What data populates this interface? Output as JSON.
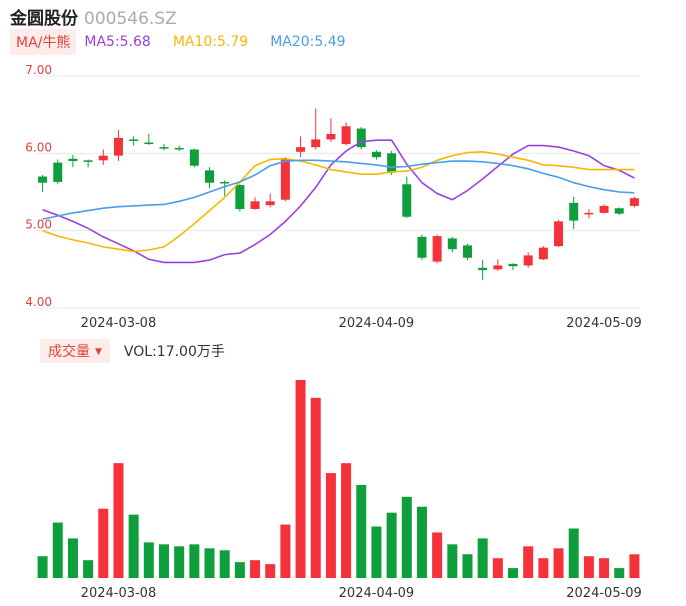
{
  "header": {
    "name": "金圆股份",
    "code": "000546.SZ"
  },
  "ma": {
    "button_label": "MA/牛熊",
    "ma5_label": "MA5:5.68",
    "ma10_label": "MA10:5.79",
    "ma20_label": "MA20:5.49",
    "colors": {
      "ma5": "#9b40e0",
      "ma10": "#f5b800",
      "ma20": "#4a9de8"
    }
  },
  "volume_header": {
    "button_label": "成交量",
    "value_label": "VOL:17.00万手"
  },
  "colors": {
    "up": "#f5323a",
    "down": "#0e9e3c"
  },
  "chart_data": [
    {
      "type": "candlestick",
      "ylim": [
        4.0,
        7.0
      ],
      "y_ticks": [
        "7.00",
        "6.00",
        "5.00",
        "4.00"
      ],
      "x_tick_labels": [
        "2024-03-08",
        "2024-04-09",
        "2024-05-09"
      ],
      "x_tick_indices": [
        5,
        22,
        37
      ],
      "candles": [
        {
          "o": 5.7,
          "c": 5.62,
          "h": 5.72,
          "l": 5.5
        },
        {
          "o": 5.88,
          "c": 5.63,
          "h": 5.92,
          "l": 5.6
        },
        {
          "o": 5.93,
          "c": 5.9,
          "h": 5.98,
          "l": 5.82
        },
        {
          "o": 5.91,
          "c": 5.89,
          "h": 5.92,
          "l": 5.82
        },
        {
          "o": 5.91,
          "c": 5.97,
          "h": 6.05,
          "l": 5.85
        },
        {
          "o": 5.97,
          "c": 6.2,
          "h": 6.3,
          "l": 5.9
        },
        {
          "o": 6.18,
          "c": 6.17,
          "h": 6.22,
          "l": 6.1
        },
        {
          "o": 6.14,
          "c": 6.12,
          "h": 6.25,
          "l": 6.11
        },
        {
          "o": 6.08,
          "c": 6.07,
          "h": 6.12,
          "l": 6.04
        },
        {
          "o": 6.07,
          "c": 6.05,
          "h": 6.1,
          "l": 6.03
        },
        {
          "o": 6.05,
          "c": 5.84,
          "h": 6.06,
          "l": 5.82
        },
        {
          "o": 5.78,
          "c": 5.62,
          "h": 5.82,
          "l": 5.55
        },
        {
          "o": 5.63,
          "c": 5.62,
          "h": 5.65,
          "l": 5.45
        },
        {
          "o": 5.59,
          "c": 5.28,
          "h": 5.6,
          "l": 5.25
        },
        {
          "o": 5.28,
          "c": 5.38,
          "h": 5.43,
          "l": 5.27
        },
        {
          "o": 5.33,
          "c": 5.38,
          "h": 5.48,
          "l": 5.3
        },
        {
          "o": 5.4,
          "c": 5.93,
          "h": 5.95,
          "l": 5.38
        },
        {
          "o": 6.02,
          "c": 6.08,
          "h": 6.22,
          "l": 5.95
        },
        {
          "o": 6.08,
          "c": 6.18,
          "h": 6.58,
          "l": 6.05
        },
        {
          "o": 6.18,
          "c": 6.25,
          "h": 6.45,
          "l": 6.15
        },
        {
          "o": 6.12,
          "c": 6.35,
          "h": 6.4,
          "l": 6.1
        },
        {
          "o": 6.32,
          "c": 6.08,
          "h": 6.34,
          "l": 6.05
        },
        {
          "o": 6.02,
          "c": 5.95,
          "h": 6.04,
          "l": 5.92
        },
        {
          "o": 6.0,
          "c": 5.75,
          "h": 6.03,
          "l": 5.72
        },
        {
          "o": 5.6,
          "c": 5.18,
          "h": 5.7,
          "l": 5.16
        },
        {
          "o": 4.92,
          "c": 4.65,
          "h": 4.95,
          "l": 4.62
        },
        {
          "o": 4.6,
          "c": 4.93,
          "h": 4.95,
          "l": 4.58
        },
        {
          "o": 4.9,
          "c": 4.76,
          "h": 4.92,
          "l": 4.72
        },
        {
          "o": 4.81,
          "c": 4.65,
          "h": 4.83,
          "l": 4.62
        },
        {
          "o": 4.52,
          "c": 4.49,
          "h": 4.62,
          "l": 4.36
        },
        {
          "o": 4.5,
          "c": 4.55,
          "h": 4.63,
          "l": 4.48
        },
        {
          "o": 4.57,
          "c": 4.54,
          "h": 4.58,
          "l": 4.49
        },
        {
          "o": 4.55,
          "c": 4.68,
          "h": 4.72,
          "l": 4.52
        },
        {
          "o": 4.63,
          "c": 4.78,
          "h": 4.8,
          "l": 4.62
        },
        {
          "o": 4.8,
          "c": 5.12,
          "h": 5.14,
          "l": 4.79
        },
        {
          "o": 5.36,
          "c": 5.13,
          "h": 5.44,
          "l": 5.02
        },
        {
          "o": 5.21,
          "c": 5.23,
          "h": 5.28,
          "l": 5.16
        },
        {
          "o": 5.23,
          "c": 5.32,
          "h": 5.34,
          "l": 5.22
        },
        {
          "o": 5.29,
          "c": 5.22,
          "h": 5.3,
          "l": 5.2
        },
        {
          "o": 5.32,
          "c": 5.42,
          "h": 5.44,
          "l": 5.3
        }
      ],
      "ma5": [
        5.27,
        5.2,
        5.12,
        5.03,
        4.92,
        4.83,
        4.74,
        4.63,
        4.59,
        4.59,
        4.59,
        4.62,
        4.69,
        4.71,
        4.82,
        4.95,
        5.12,
        5.32,
        5.56,
        5.85,
        6.03,
        6.15,
        6.17,
        6.17,
        5.86,
        5.62,
        5.48,
        5.4,
        5.52,
        5.67,
        5.83,
        5.99,
        6.1,
        6.1,
        6.08,
        6.03,
        5.97,
        5.84,
        5.78,
        5.68
      ],
      "ma10": [
        5.0,
        4.93,
        4.88,
        4.84,
        4.79,
        4.76,
        4.73,
        4.75,
        4.79,
        4.93,
        5.09,
        5.26,
        5.43,
        5.63,
        5.84,
        5.92,
        5.93,
        5.9,
        5.85,
        5.79,
        5.76,
        5.73,
        5.73,
        5.76,
        5.77,
        5.82,
        5.91,
        5.97,
        6.01,
        6.02,
        5.99,
        5.95,
        5.91,
        5.85,
        5.84,
        5.82,
        5.79,
        5.79,
        5.79,
        5.79
      ],
      "ma20": [
        5.15,
        5.19,
        5.23,
        5.26,
        5.29,
        5.31,
        5.32,
        5.33,
        5.34,
        5.38,
        5.43,
        5.5,
        5.57,
        5.63,
        5.72,
        5.84,
        5.9,
        5.91,
        5.91,
        5.9,
        5.89,
        5.87,
        5.85,
        5.82,
        5.83,
        5.86,
        5.88,
        5.9,
        5.9,
        5.89,
        5.87,
        5.84,
        5.8,
        5.74,
        5.69,
        5.62,
        5.57,
        5.53,
        5.5,
        5.49
      ]
    },
    {
      "type": "bar",
      "name": "成交量",
      "value_label": "VOL:17.00万手",
      "x_tick_labels": [
        "2024-03-08",
        "2024-04-09",
        "2024-05-09"
      ],
      "x_tick_indices": [
        5,
        22,
        37
      ],
      "values": [
        11,
        28,
        20,
        9,
        35,
        58,
        32,
        18,
        17,
        16,
        17,
        15,
        14,
        8,
        9,
        7,
        27,
        100,
        91,
        53,
        58,
        47,
        26,
        33,
        41,
        36,
        23,
        17,
        12,
        20,
        10,
        5,
        16,
        10,
        15,
        25,
        11,
        10,
        5,
        12
      ],
      "ymax": 100
    }
  ]
}
